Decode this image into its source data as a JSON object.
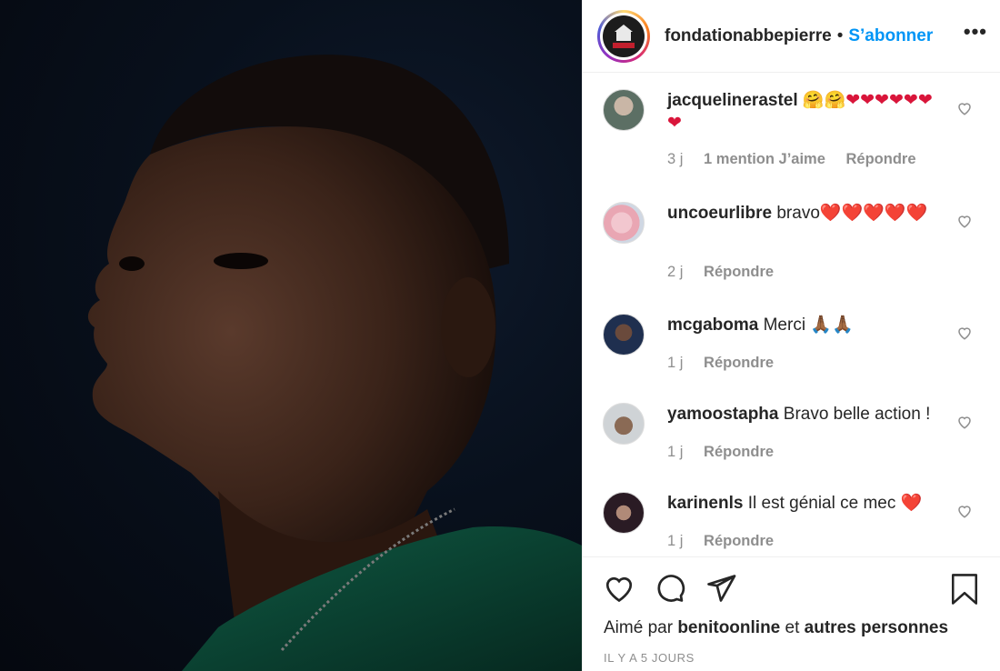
{
  "post": {
    "account": "fondationabbepierre",
    "separator": "•",
    "follow_label": "S’abonner",
    "more_label": "•••",
    "avatar_icon": "fondation-logo-icon"
  },
  "comments": [
    {
      "user": "jacquelinerastel",
      "text": "🤗🤗❤❤❤❤❤❤❤",
      "time": "3 j",
      "likes": "1 mention J’aime",
      "reply": "Répondre"
    },
    {
      "user": "uncoeurlibre",
      "text": "bravo❤️❤️❤️❤️❤️",
      "time": "2 j",
      "likes": "",
      "reply": "Répondre"
    },
    {
      "user": "mcgaboma",
      "text": "Merci 🙏🏾🙏🏾",
      "time": "1 j",
      "likes": "",
      "reply": "Répondre"
    },
    {
      "user": "yamoostapha",
      "text": "Bravo belle action !",
      "time": "1 j",
      "likes": "",
      "reply": "Répondre"
    },
    {
      "user": "karinenls",
      "text": "Il est génial ce mec ❤️",
      "time": "1 j",
      "likes": "",
      "reply": "Répondre"
    }
  ],
  "footer": {
    "liked_prefix": "Aimé par",
    "liked_user": "benitoonline",
    "liked_and": "et",
    "liked_others": "autres personnes",
    "timestamp": "IL Y A 5 JOURS"
  },
  "colors": {
    "accent": "#0095f6",
    "heart_red": "#d9153a",
    "meta_gray": "#8e8e8e"
  }
}
